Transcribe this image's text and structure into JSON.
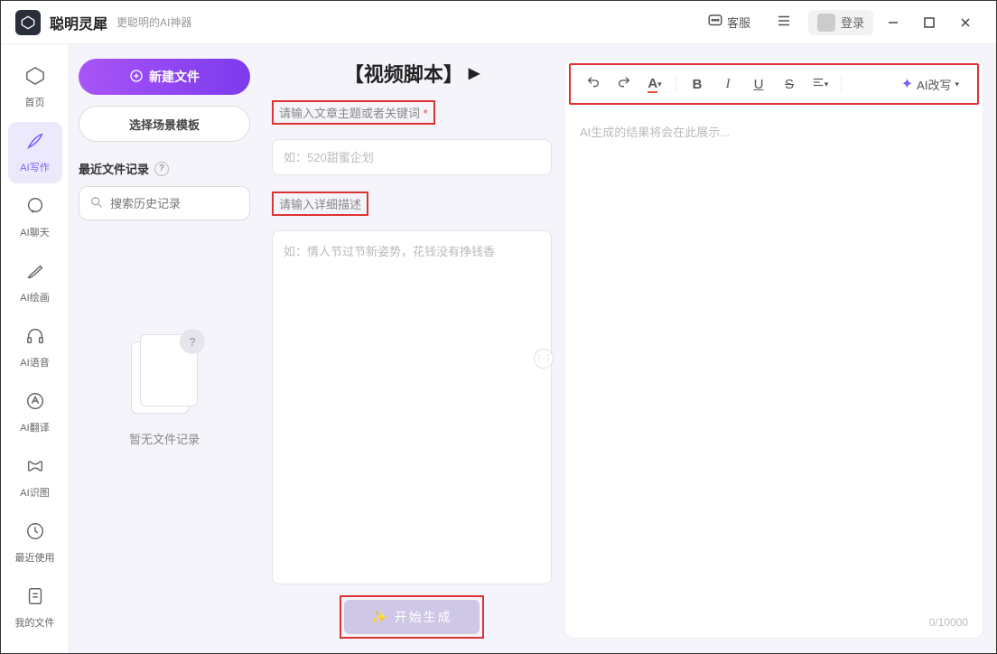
{
  "titlebar": {
    "app_name": "聪明灵犀",
    "app_sub": "更聪明的AI神器",
    "service": "客服",
    "login": "登录"
  },
  "sidebar": {
    "items": [
      {
        "label": "首页"
      },
      {
        "label": "AI写作"
      },
      {
        "label": "AI聊天"
      },
      {
        "label": "AI绘画"
      },
      {
        "label": "AI语音"
      },
      {
        "label": "AI翻译"
      },
      {
        "label": "AI识图"
      },
      {
        "label": "最近使用"
      },
      {
        "label": "我的文件"
      }
    ]
  },
  "filepanel": {
    "new_file": "新建文件",
    "template": "选择场景模板",
    "recent": "最近文件记录",
    "search_placeholder": "搜索历史记录",
    "empty": "暂无文件记录"
  },
  "editor": {
    "title": "【视频脚本】",
    "subject_label": "请输入文章主题或者关键词",
    "subject_placeholder": "如：520甜蜜企划",
    "detail_label": "请输入详细描述",
    "detail_placeholder": "如：情人节过节新姿势，花钱没有挣钱香",
    "generate": "✨ 开始生成",
    "output_placeholder": "AI生成的结果将会在此展示...",
    "rewrite": "AI改写",
    "counter": "0/10000"
  }
}
